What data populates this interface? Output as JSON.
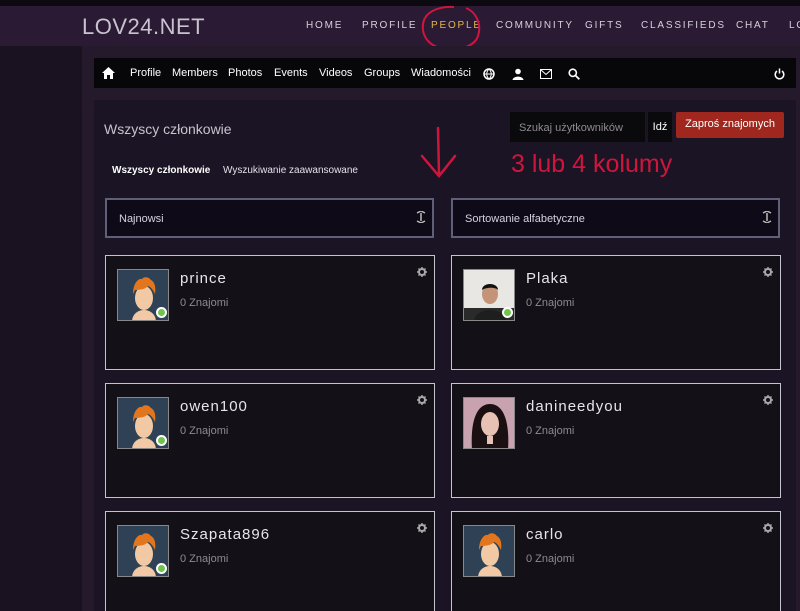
{
  "header": {
    "logo": "LOV24.NET",
    "nav": [
      "HOME",
      "PROFILE",
      "PEOPLE",
      "COMMUNITY",
      "GIFTS",
      "CLASSIFIEDS",
      "CHAT",
      "LO"
    ],
    "active_index": 2
  },
  "subnav": {
    "items": [
      "Profile",
      "Members",
      "Photos",
      "Events",
      "Videos",
      "Groups",
      "Wiadomości"
    ],
    "icons": [
      "home-icon",
      "globe-icon",
      "user-icon",
      "envelope-icon",
      "search-icon",
      "power-icon"
    ]
  },
  "panel": {
    "title": "Wszyscy członkowie",
    "search_placeholder": "Szukaj użytkowników",
    "go_label": "Idź",
    "invite_label": "Zaproś znajomych",
    "tabs": [
      "Wszyscy członkowie",
      "Wyszukiwanie zaawansowane"
    ],
    "annotation": "3 lub 4 kolumy",
    "sort1": "Najnowsi",
    "sort2": "Sortowanie alfabetyczne"
  },
  "members": [
    {
      "name": "prince",
      "friends": "0 Znajomi",
      "avatar": "default",
      "online": true
    },
    {
      "name": "Plaka",
      "friends": "0 Znajomi",
      "avatar": "photo-man",
      "online": true
    },
    {
      "name": "owen100",
      "friends": "0 Znajomi",
      "avatar": "default",
      "online": true
    },
    {
      "name": "danineedyou",
      "friends": "0 Znajomi",
      "avatar": "photo-woman",
      "online": false
    },
    {
      "name": "Szapata896",
      "friends": "0 Znajomi",
      "avatar": "default",
      "online": true
    },
    {
      "name": "carlo",
      "friends": "0 Znajomi",
      "avatar": "default",
      "online": false
    }
  ],
  "colors": {
    "accent": "#e6b64a",
    "invite": "#a0271e",
    "annotation": "#d0153d",
    "online": "#6fc54a"
  }
}
